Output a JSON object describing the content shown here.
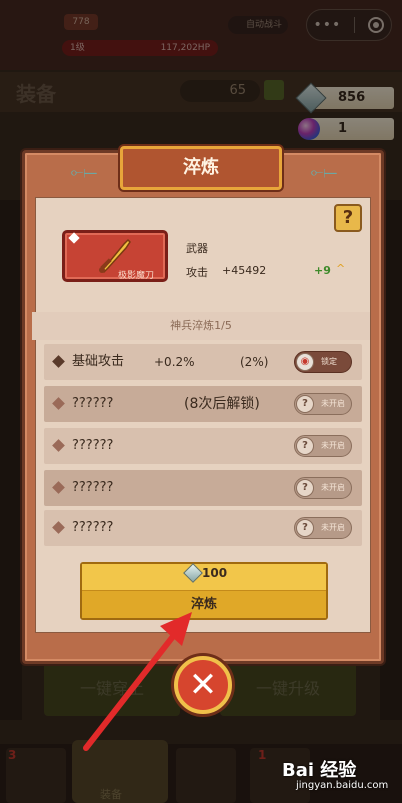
{
  "top": {
    "level": "778",
    "hp_left": "1级",
    "hp_right": "117,202HP",
    "auto_label": "自动战斗"
  },
  "header": {
    "title": "装备",
    "power": "65"
  },
  "resources": {
    "gem_count": "856",
    "orb_count": "1"
  },
  "modal": {
    "title": "淬炼",
    "help": "?",
    "item": {
      "name": "极影魔刀",
      "type": "武器",
      "attack_label": "攻击",
      "attack_value": "+45492",
      "level": "+9"
    },
    "section_title": "神兵淬炼1/5",
    "rows": [
      {
        "label": "基础攻击",
        "pct": "+0.2%",
        "range": "(2%)",
        "btn": "锁定"
      },
      {
        "label": "??????",
        "note": "(8次后解锁)",
        "btn": "未开启"
      },
      {
        "label": "??????",
        "btn": "未开启"
      },
      {
        "label": "??????",
        "btn": "未开启"
      },
      {
        "label": "??????",
        "btn": "未开启"
      }
    ],
    "cost": "100",
    "refine_label": "淬炼"
  },
  "bottom": {
    "left_btn": "一键穿上",
    "right_btn": "一键升级",
    "tab_active": "装备",
    "tab_num_1": "3",
    "tab_num_2": "1"
  },
  "watermark": {
    "brand": "Bai 经验",
    "url": "jingyan.baidu.com"
  }
}
